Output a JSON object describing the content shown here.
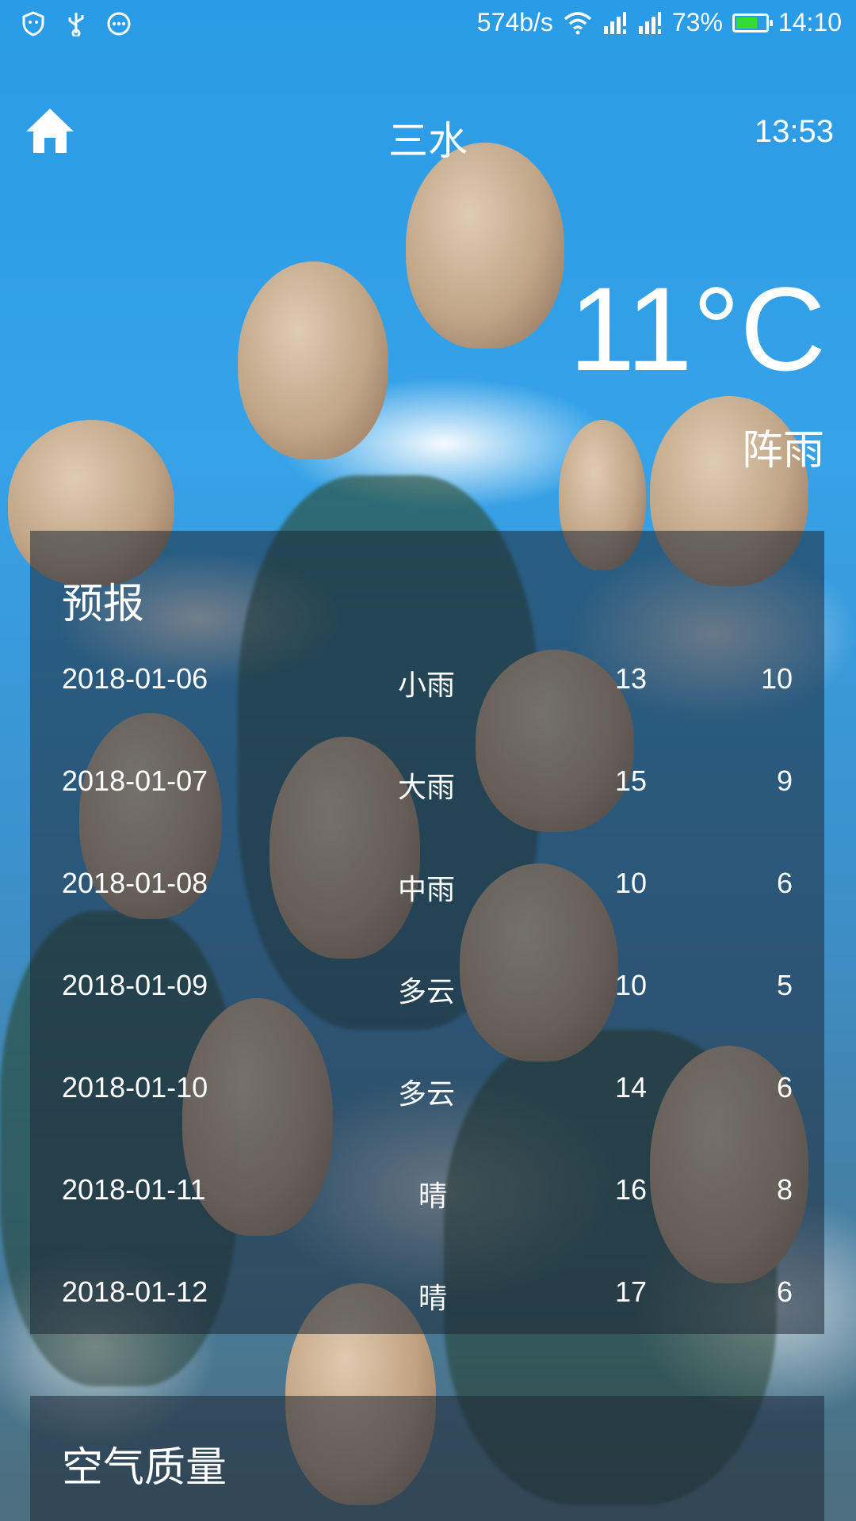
{
  "status_bar": {
    "net_speed": "574b/s",
    "battery": "73%",
    "battery_level": 0.73,
    "time": "14:10",
    "left_icons": [
      "shield-icon",
      "usb-icon",
      "more-icon"
    ],
    "right_icons": [
      "wifi-icon",
      "signal-icon",
      "signal-icon"
    ]
  },
  "header": {
    "city": "三水",
    "update_time": "13:53"
  },
  "now": {
    "temperature": "11°C",
    "condition": "阵雨"
  },
  "forecast": {
    "title": "预报",
    "days": [
      {
        "date": "2018-01-06",
        "cond": "小雨",
        "max": "13",
        "min": "10"
      },
      {
        "date": "2018-01-07",
        "cond": "大雨",
        "max": "15",
        "min": "9"
      },
      {
        "date": "2018-01-08",
        "cond": "中雨",
        "max": "10",
        "min": "6"
      },
      {
        "date": "2018-01-09",
        "cond": "多云",
        "max": "10",
        "min": "5"
      },
      {
        "date": "2018-01-10",
        "cond": "多云",
        "max": "14",
        "min": "6"
      },
      {
        "date": "2018-01-11",
        "cond": "晴",
        "max": "16",
        "min": "8"
      },
      {
        "date": "2018-01-12",
        "cond": "晴",
        "max": "17",
        "min": "6"
      }
    ]
  },
  "air_quality": {
    "title": "空气质量"
  }
}
